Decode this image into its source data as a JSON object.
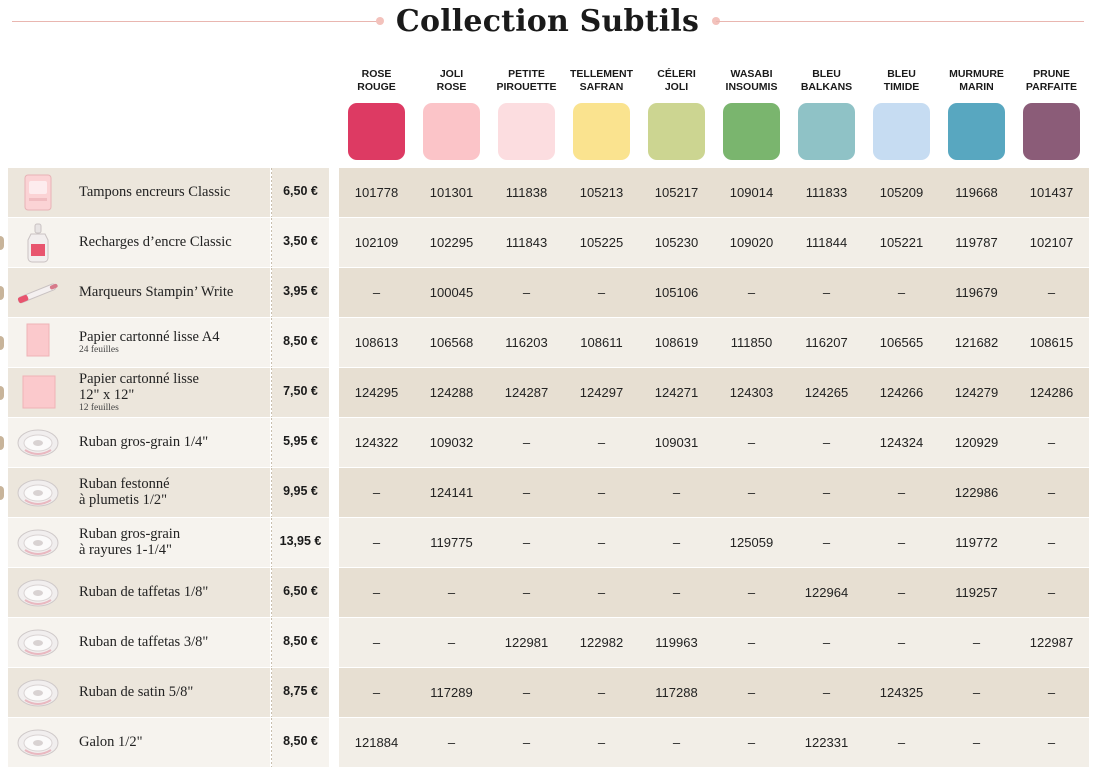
{
  "title": "Collection Subtils",
  "colors": [
    {
      "name": [
        "ROSE",
        "ROUGE"
      ],
      "hex": "#dd3a63"
    },
    {
      "name": [
        "JOLI",
        "ROSE"
      ],
      "hex": "#fbc4c8"
    },
    {
      "name": [
        "PETITE",
        "PIROUETTE"
      ],
      "hex": "#fcdde0"
    },
    {
      "name": [
        "TELLEMENT",
        "SAFRAN"
      ],
      "hex": "#fae38f"
    },
    {
      "name": [
        "CÉLERI",
        "JOLI"
      ],
      "hex": "#ccd591"
    },
    {
      "name": [
        "WASABI",
        "INSOUMIS"
      ],
      "hex": "#7ab56e"
    },
    {
      "name": [
        "BLEU",
        "BALKANS"
      ],
      "hex": "#8fc2c6"
    },
    {
      "name": [
        "BLEU",
        "TIMIDE"
      ],
      "hex": "#c6dcf2"
    },
    {
      "name": [
        "MURMURE",
        "MARIN"
      ],
      "hex": "#58a7c0"
    },
    {
      "name": [
        "PRUNE",
        "PARFAITE"
      ],
      "hex": "#8b5c78"
    }
  ],
  "products": [
    {
      "name": [
        "Tampons encreurs Classic"
      ],
      "sub": "",
      "price": "6,50 €",
      "icon": "ink-pad-icon",
      "codes": [
        "101778",
        "101301",
        "111838",
        "105213",
        "105217",
        "109014",
        "111833",
        "105209",
        "119668",
        "101437"
      ]
    },
    {
      "name": [
        "Recharges d’encre Classic"
      ],
      "sub": "",
      "price": "3,50 €",
      "icon": "ink-refill-icon",
      "codes": [
        "102109",
        "102295",
        "111843",
        "105225",
        "105230",
        "109020",
        "111844",
        "105221",
        "119787",
        "102107"
      ]
    },
    {
      "name": [
        "Marqueurs Stampin’ Write"
      ],
      "sub": "",
      "price": "3,95 €",
      "icon": "marker-icon",
      "codes": [
        "–",
        "100045",
        "–",
        "–",
        "105106",
        "–",
        "–",
        "–",
        "119679",
        "–"
      ]
    },
    {
      "name": [
        "Papier cartonné lisse A4"
      ],
      "sub": "24 feuilles",
      "price": "8,50 €",
      "icon": "cardstock-a4-icon",
      "codes": [
        "108613",
        "106568",
        "116203",
        "108611",
        "108619",
        "111850",
        "116207",
        "106565",
        "121682",
        "108615"
      ]
    },
    {
      "name": [
        "Papier cartonné lisse",
        "12\" x 12\""
      ],
      "sub": "12 feuilles",
      "price": "7,50 €",
      "icon": "cardstock-12x12-icon",
      "codes": [
        "124295",
        "124288",
        "124287",
        "124297",
        "124271",
        "124303",
        "124265",
        "124266",
        "124279",
        "124286"
      ]
    },
    {
      "name": [
        "Ruban gros-grain 1/4\""
      ],
      "sub": "",
      "price": "5,95 €",
      "icon": "ribbon-spool-icon",
      "codes": [
        "124322",
        "109032",
        "–",
        "–",
        "109031",
        "–",
        "–",
        "124324",
        "120929",
        "–"
      ]
    },
    {
      "name": [
        "Ruban festonné",
        "à plumetis 1/2\""
      ],
      "sub": "",
      "price": "9,95 €",
      "icon": "ribbon-spool-icon",
      "codes": [
        "–",
        "124141",
        "–",
        "–",
        "–",
        "–",
        "–",
        "–",
        "122986",
        "–"
      ]
    },
    {
      "name": [
        "Ruban gros-grain",
        "à rayures 1-1/4\""
      ],
      "sub": "",
      "price": "13,95 €",
      "icon": "ribbon-spool-icon",
      "codes": [
        "–",
        "119775",
        "–",
        "–",
        "–",
        "125059",
        "–",
        "–",
        "119772",
        "–"
      ]
    },
    {
      "name": [
        "Ruban de taffetas 1/8\""
      ],
      "sub": "",
      "price": "6,50 €",
      "icon": "ribbon-spool-icon",
      "codes": [
        "–",
        "–",
        "–",
        "–",
        "–",
        "–",
        "122964",
        "–",
        "119257",
        "–"
      ]
    },
    {
      "name": [
        "Ruban de taffetas 3/8\""
      ],
      "sub": "",
      "price": "8,50 €",
      "icon": "ribbon-spool-icon",
      "codes": [
        "–",
        "–",
        "122981",
        "122982",
        "119963",
        "–",
        "–",
        "–",
        "–",
        "122987"
      ]
    },
    {
      "name": [
        "Ruban de satin 5/8\""
      ],
      "sub": "",
      "price": "8,75 €",
      "icon": "ribbon-spool-icon",
      "codes": [
        "–",
        "117289",
        "–",
        "–",
        "117288",
        "–",
        "–",
        "124325",
        "–",
        "–"
      ]
    },
    {
      "name": [
        "Galon 1/2\""
      ],
      "sub": "",
      "price": "8,50 €",
      "icon": "ribbon-spool-icon",
      "codes": [
        "121884",
        "–",
        "–",
        "–",
        "–",
        "–",
        "122331",
        "–",
        "–",
        "–"
      ]
    }
  ]
}
